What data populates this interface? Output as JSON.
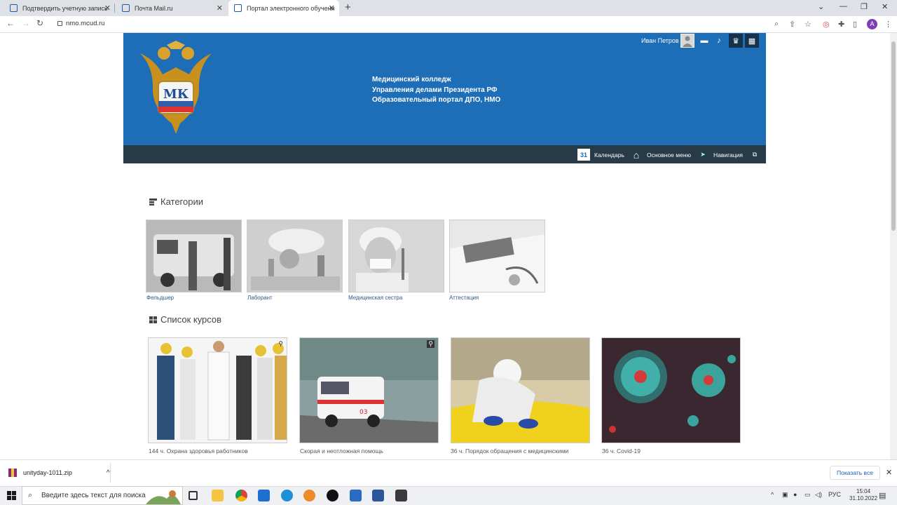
{
  "browser": {
    "tabs": [
      {
        "title": "Подтвердить учетную запись"
      },
      {
        "title": "Почта Mail.ru"
      },
      {
        "title": "Портал электронного обучени"
      }
    ],
    "url": "nmo.mcud.ru",
    "profile_initial": "A"
  },
  "site": {
    "title_lines": [
      "Медицинский колледж",
      "Управления делами Президента РФ",
      "Образовательный портал ДПО, НМО"
    ],
    "logo_text": "МК",
    "user_name": "Иван Петров",
    "calendar_day": "31",
    "nav": {
      "calendar": "Календарь",
      "main_menu": "Основное меню",
      "navigation": "Навигация"
    }
  },
  "categories": {
    "title": "Категории",
    "items": [
      "Фельдшер",
      "Лаборант",
      "Медицинская сестра",
      "Аттестация"
    ]
  },
  "courses": {
    "title": "Список курсов",
    "items": [
      "144 ч. Охрана здоровья работников",
      "Скорая и неотложная помощь",
      "36 ч. Порядок обращения с медицинскими",
      "36 ч. Covid-19"
    ]
  },
  "downloads": {
    "file": "unityday-1011.zip",
    "show_all": "Показать все"
  },
  "taskbar": {
    "search_placeholder": "Введите здесь текст для поиска",
    "lang": "РУС",
    "time": "15:04",
    "date": "31.10.2022"
  }
}
